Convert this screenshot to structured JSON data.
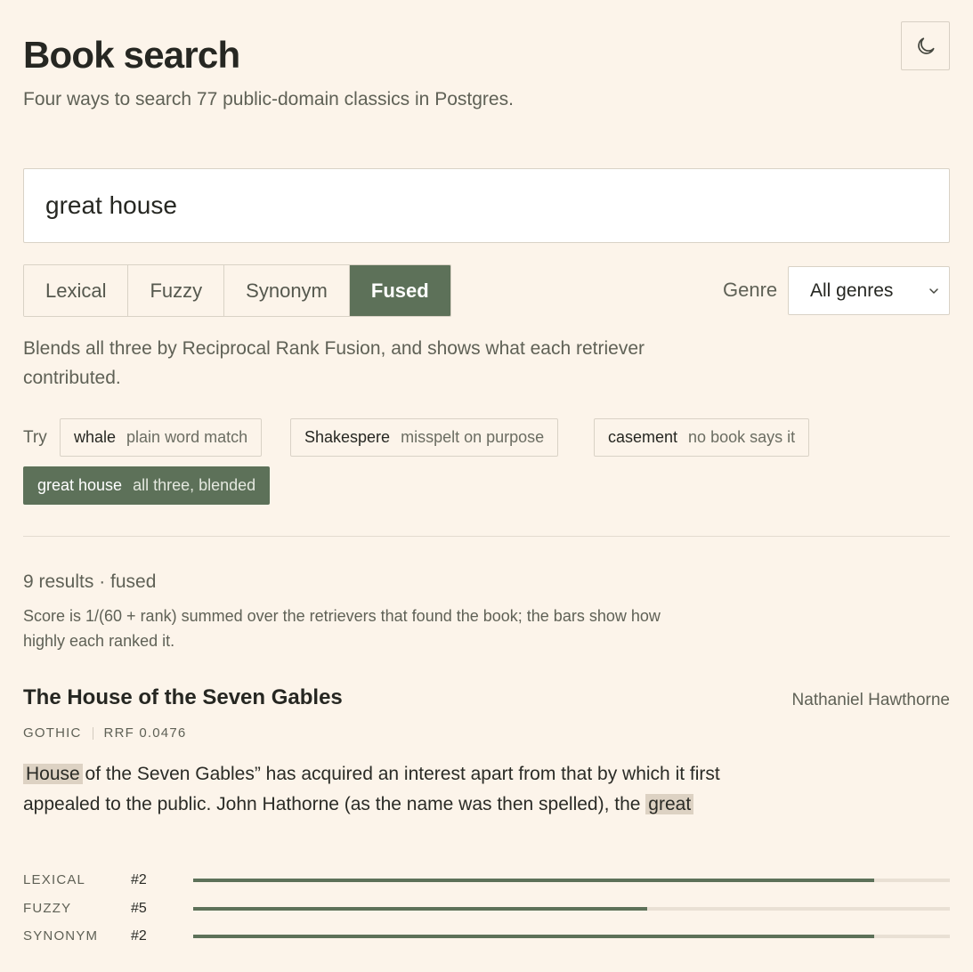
{
  "header": {
    "title": "Book search",
    "subtitle": "Four ways to search 77 public-domain classics in Postgres.",
    "theme_icon": "moon-icon"
  },
  "search": {
    "value": "great house"
  },
  "modes": [
    {
      "label": "Lexical",
      "active": false
    },
    {
      "label": "Fuzzy",
      "active": false
    },
    {
      "label": "Synonym",
      "active": false
    },
    {
      "label": "Fused",
      "active": true
    }
  ],
  "genre": {
    "label": "Genre",
    "selected": "All genres"
  },
  "mode_description": "Blends all three by Reciprocal Rank Fusion, and shows what each retriever contributed.",
  "try": {
    "label": "Try",
    "examples": [
      {
        "query": "whale",
        "hint": "plain word match",
        "active": false
      },
      {
        "query": "Shakespere",
        "hint": "misspelt on purpose",
        "active": false
      },
      {
        "query": "casement",
        "hint": "no book says it",
        "active": false
      },
      {
        "query": "great house",
        "hint": "all three, blended",
        "active": true
      }
    ]
  },
  "results": {
    "count_text": "9 results · fused",
    "score_note": "Score is 1/(60 + rank) summed over the retrievers that found the book; the bars show how highly each ranked it.",
    "items": [
      {
        "title": "The House of the Seven Gables",
        "author": "Nathaniel Hawthorne",
        "genre": "GOTHIC",
        "score": "RRF 0.0476",
        "snippet": {
          "hl1": "House",
          "mid": " of the Seven Gables” has acquired an interest apart from that by which it first appealed to the public. John Hathorne (as the name was then spelled), the ",
          "hl2": "great"
        },
        "retrievers": [
          {
            "name": "LEXICAL",
            "rank": "#2",
            "strength": 0.9
          },
          {
            "name": "FUZZY",
            "rank": "#5",
            "strength": 0.6
          },
          {
            "name": "SYNONYM",
            "rank": "#2",
            "strength": 0.9
          }
        ]
      }
    ]
  },
  "colors": {
    "background": "#fcf4ea",
    "accent": "#5d7159",
    "highlight": "#ddd2c3"
  }
}
